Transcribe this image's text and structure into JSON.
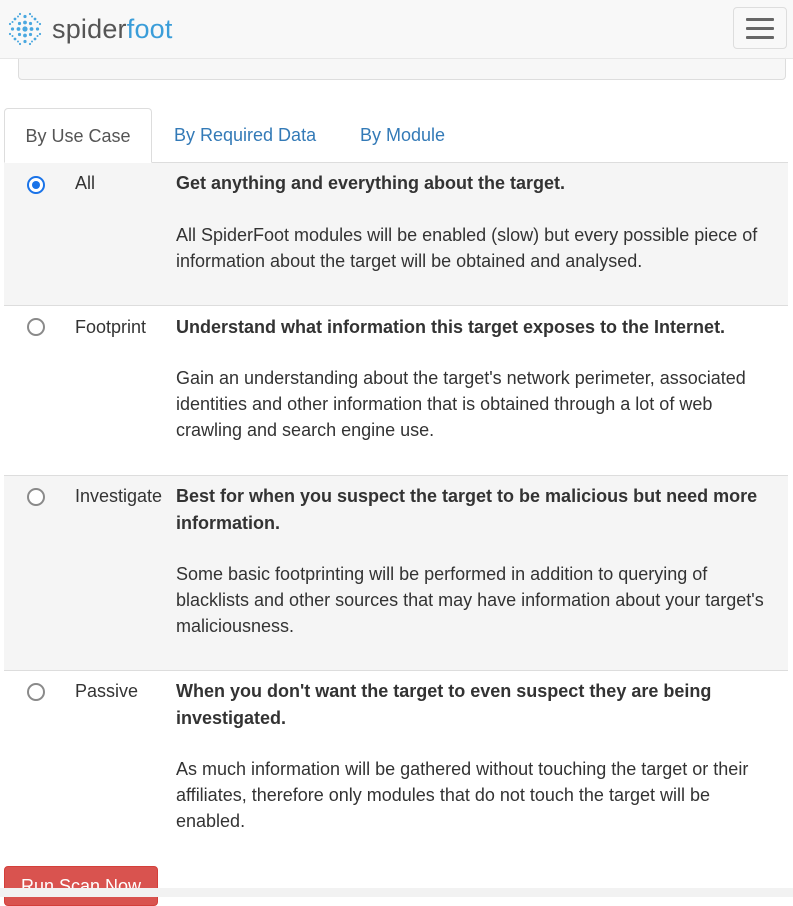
{
  "brand": {
    "name_part1": "spider",
    "name_part2": "foot",
    "logo_icon": "spiderfoot-snowflake-logo",
    "color_part1": "#555555",
    "color_part2": "#3a9dd9"
  },
  "navbar": {
    "toggle_icon": "hamburger-menu-icon"
  },
  "tabs": [
    {
      "label": "By Use Case",
      "active": true
    },
    {
      "label": "By Required Data",
      "active": false
    },
    {
      "label": "By Module",
      "active": false
    }
  ],
  "use_cases": [
    {
      "name": "All",
      "selected": true,
      "title": "Get anything and everything about the target.",
      "description": "All SpiderFoot modules will be enabled (slow) but every possible piece of information about the target will be obtained and analysed."
    },
    {
      "name": "Footprint",
      "selected": false,
      "title": "Understand what information this target exposes to the Internet.",
      "description": "Gain an understanding about the target's network perimeter, associated identities and other information that is obtained through a lot of web crawling and search engine use."
    },
    {
      "name": "Investigate",
      "selected": false,
      "title": "Best for when you suspect the target to be malicious but need more information.",
      "description": "Some basic footprinting will be performed in addition to querying of blacklists and other sources that may have information about your target's maliciousness."
    },
    {
      "name": "Passive",
      "selected": false,
      "title": "When you don't want the target to even suspect they are being investigated.",
      "description": "As much information will be gathered without touching the target or their affiliates, therefore only modules that do not touch the target will be enabled."
    }
  ],
  "run_button": {
    "label": "Run Scan Now",
    "color": "#d9534f"
  },
  "colors": {
    "link": "#337ab7",
    "radio_checked": "#1a73e8"
  }
}
